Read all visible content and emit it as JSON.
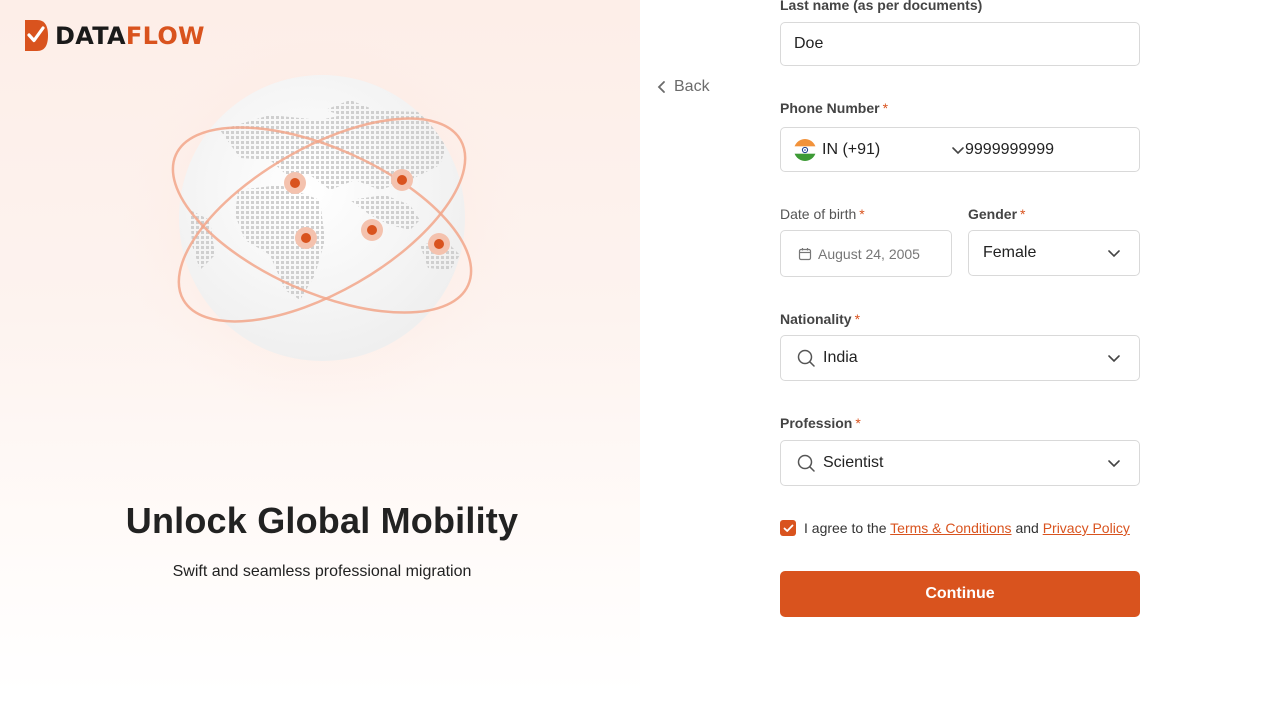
{
  "brand": {
    "name_part1": "DATA",
    "name_part2": "FLOW",
    "accent": "#d9531e"
  },
  "hero": {
    "title": "Unlock Global Mobility",
    "subtitle": "Swift and seamless professional migration"
  },
  "nav": {
    "back_label": "Back",
    "back_icon": "chevron-left-icon"
  },
  "form": {
    "last_name": {
      "label": "Last name (as per documents)",
      "value": "Doe"
    },
    "phone": {
      "label": "Phone Number",
      "required_mark": "*",
      "country": "IN (+91)",
      "flag_icon": "india-flag-icon",
      "value": "9999999999"
    },
    "dob": {
      "label": "Date of birth",
      "required_mark": "*",
      "value": "August 24, 2005",
      "icon": "calendar-icon"
    },
    "gender": {
      "label": "Gender",
      "required_mark": "*",
      "value": "Female"
    },
    "nationality": {
      "label": "Nationality",
      "required_mark": "*",
      "value": "India",
      "icon": "search-icon"
    },
    "profession": {
      "label": "Profession",
      "required_mark": "*",
      "value": "Scientist",
      "icon": "search-icon"
    },
    "agreement": {
      "checked": true,
      "prefix": "I agree to the",
      "terms_link": "Terms & Conditions",
      "middle": "and",
      "privacy_link": "Privacy Policy"
    },
    "submit_label": "Continue"
  }
}
